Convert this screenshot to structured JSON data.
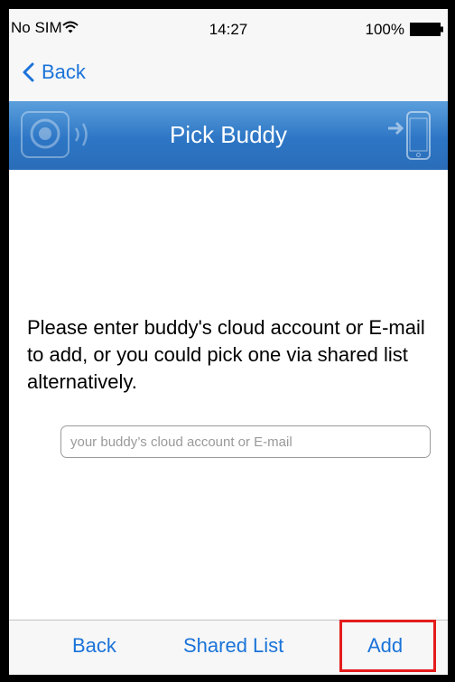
{
  "status_bar": {
    "carrier": "No SIM",
    "time": "14:27",
    "battery_percent": "100%"
  },
  "nav": {
    "back_label": "Back"
  },
  "header": {
    "title": "Pick Buddy"
  },
  "main": {
    "instructions": "Please enter buddy's cloud account or E-mail to add, or you could pick one via shared list alternatively.",
    "input_placeholder": "your buddy’s cloud account or E-mail",
    "input_value": ""
  },
  "toolbar": {
    "back_label": "Back",
    "shared_list_label": "Shared List",
    "add_label": "Add"
  },
  "colors": {
    "accent": "#1a73d9",
    "header_blue": "#2d76c5",
    "highlight_red": "#e41c1c"
  },
  "icons": [
    "wifi-icon",
    "battery-icon",
    "back-chevron-icon",
    "camera-icon",
    "phone-icon"
  ]
}
